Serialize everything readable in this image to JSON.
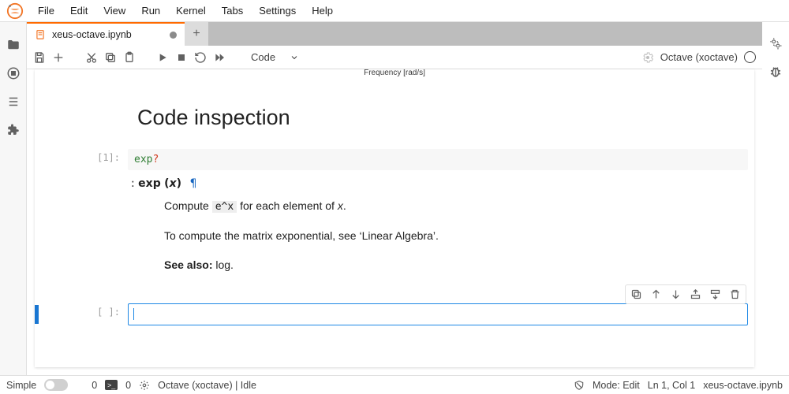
{
  "menu": {
    "items": [
      "File",
      "Edit",
      "View",
      "Run",
      "Kernel",
      "Tabs",
      "Settings",
      "Help"
    ]
  },
  "left_rail": [
    "folder-icon",
    "running-icon",
    "toc-icon",
    "extensions-icon"
  ],
  "right_rail": [
    "inspector-gear-icon",
    "debugger-bug-icon"
  ],
  "tab": {
    "title": "xeus-octave.ipynb",
    "dirty": true
  },
  "toolbar": {
    "celltype": "Code",
    "kernel_display": "Octave (xoctave)"
  },
  "notebook": {
    "axis_label_remnant": "Frequency [rad/s]",
    "heading": "Code inspection",
    "cell1": {
      "prompt": "[1]:",
      "code_name": "exp",
      "code_suffix": "?",
      "doc": {
        "sig_prefix": ":",
        "fn": "exp",
        "args_open": "(",
        "arg": "x",
        "args_close": ")",
        "p1_pre": "Compute ",
        "p1_code": "e^x",
        "p1_mid": " for each element of ",
        "p1_var": "x",
        "p1_post": ".",
        "p2": "To compute the matrix exponential, see ‘Linear Algebra’.",
        "seealso_label": "See also:",
        "seealso_val": " log."
      }
    },
    "cell2": {
      "prompt": "[ ]:"
    }
  },
  "statusbar": {
    "simple": "Simple",
    "count1": "0",
    "count2": "0",
    "kernel": "Octave (xoctave) | Idle",
    "mode": "Mode: Edit",
    "pos": "Ln 1, Col 1",
    "filename": "xeus-octave.ipynb"
  }
}
